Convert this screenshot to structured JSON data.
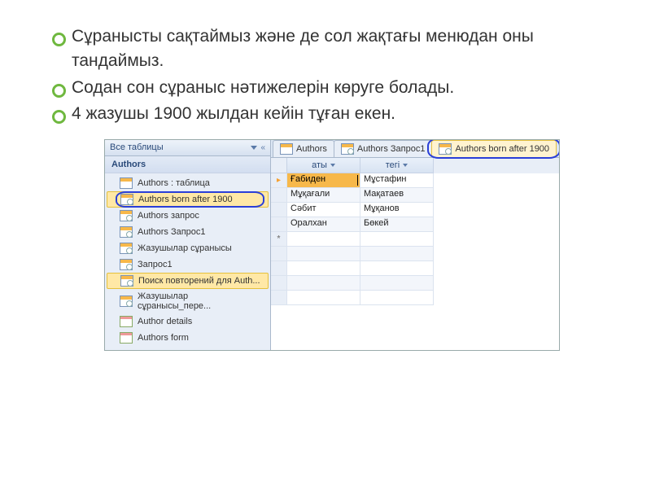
{
  "bullets": [
    "Сұранысты сақтаймыз және де сол жақтағы менюдан оны тандаймыз.",
    "Содан сон сұраныс нәтижелерін көруге болады.",
    "4 жазушы 1900 жылдан кейін тұған екен."
  ],
  "nav": {
    "header": "Все таблицы",
    "group": "Authors",
    "items": [
      {
        "label": "Authors : таблица",
        "type": "table",
        "selected": false,
        "circled": false
      },
      {
        "label": "Authors born after 1900",
        "type": "query",
        "selected": true,
        "circled": true
      },
      {
        "label": "Authors запрос",
        "type": "query",
        "selected": false,
        "circled": false
      },
      {
        "label": "Authors Запрос1",
        "type": "query",
        "selected": false,
        "circled": false
      },
      {
        "label": "Жазушылар сұранысы",
        "type": "query",
        "selected": false,
        "circled": false
      },
      {
        "label": "Запрос1",
        "type": "query",
        "selected": false,
        "circled": false
      },
      {
        "label": "Поиск повторений для Auth...",
        "type": "query",
        "selected": true,
        "circled": false
      },
      {
        "label": "Жазушылар сұранысы_пере...",
        "type": "query",
        "selected": false,
        "circled": false
      },
      {
        "label": "Author details",
        "type": "form",
        "selected": false,
        "circled": false
      },
      {
        "label": "Authors form",
        "type": "form",
        "selected": false,
        "circled": false
      }
    ]
  },
  "tabs": [
    {
      "label": "Authors",
      "type": "table",
      "active": false,
      "circled": false
    },
    {
      "label": "Authors Запрос1",
      "type": "query",
      "active": false,
      "circled": false
    },
    {
      "label": "Authors born after 1900",
      "type": "query",
      "active": true,
      "circled": true
    }
  ],
  "columns": [
    "аты",
    "тегі"
  ],
  "rows": [
    {
      "c0": "Ғабиден",
      "c1": "Мұстафин",
      "active": true
    },
    {
      "c0": "Мұқағали",
      "c1": "Мақатаев",
      "active": false
    },
    {
      "c0": "Сәбит",
      "c1": "Мұқанов",
      "active": false
    },
    {
      "c0": "Оралхан",
      "c1": "Бөкей",
      "active": false
    }
  ],
  "newrow_marker": "*",
  "rowpointer": "▸"
}
